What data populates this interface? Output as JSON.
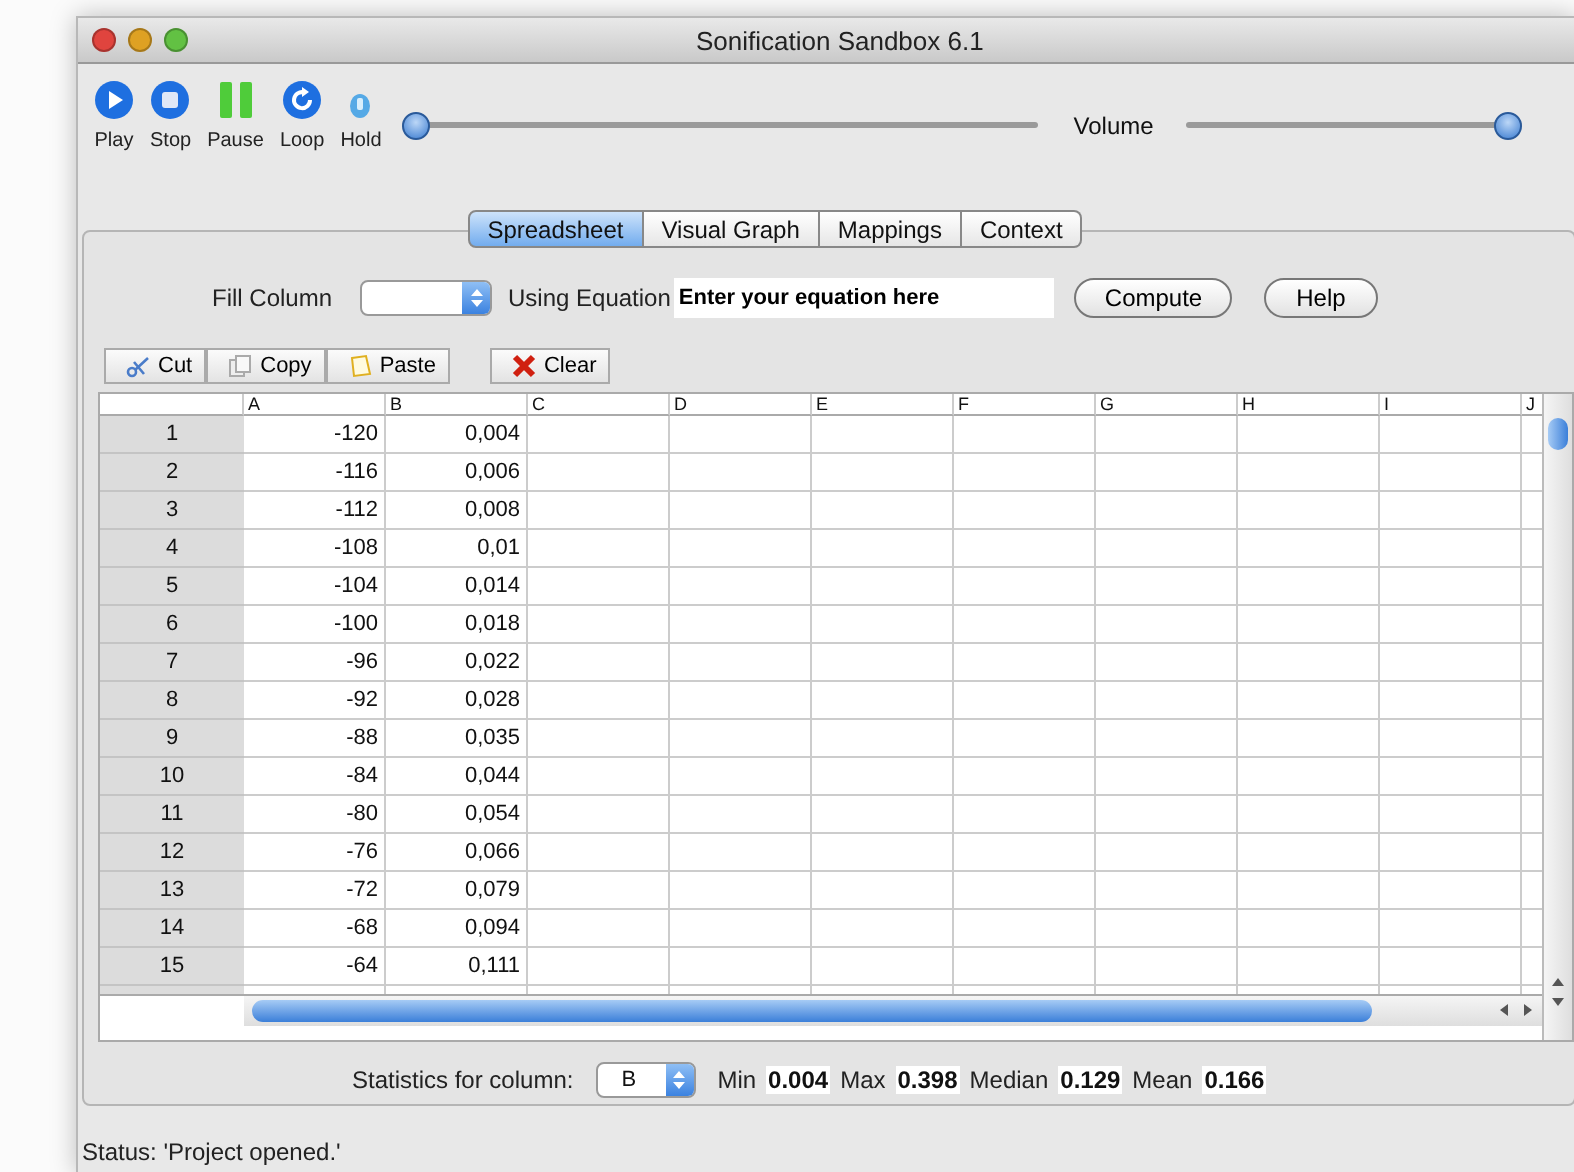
{
  "window": {
    "title": "Sonification Sandbox 6.1"
  },
  "toolbar": {
    "buttons": [
      {
        "label": "Play",
        "kind": "play"
      },
      {
        "label": "Stop",
        "kind": "stop"
      },
      {
        "label": "Pause",
        "kind": "pause"
      },
      {
        "label": "Loop",
        "kind": "loop"
      },
      {
        "label": "Hold",
        "kind": "hold"
      }
    ],
    "position_slider": {
      "level": 0
    },
    "volume": {
      "label": "Volume",
      "level": 1
    }
  },
  "tabs": [
    {
      "label": "Spreadsheet",
      "selected": true
    },
    {
      "label": "Visual Graph",
      "selected": false
    },
    {
      "label": "Mappings",
      "selected": false
    },
    {
      "label": "Context",
      "selected": false
    }
  ],
  "fill": {
    "label": "Fill Column",
    "equation_label": "Using Equation",
    "equation_placeholder": "Enter your equation here",
    "compute": "Compute",
    "help": "Help"
  },
  "edit_buttons": [
    {
      "label": "Cut",
      "kind": "cut"
    },
    {
      "label": "Copy",
      "kind": "copy"
    },
    {
      "label": "Paste",
      "kind": "paste"
    },
    {
      "label": "Clear",
      "kind": "clear"
    }
  ],
  "table": {
    "columns": [
      "A",
      "B",
      "C",
      "D",
      "E",
      "F",
      "G",
      "H",
      "I",
      "J"
    ],
    "rows": [
      {
        "index": "1",
        "cells": [
          "-120",
          "0,004"
        ]
      },
      {
        "index": "2",
        "cells": [
          "-116",
          "0,006"
        ]
      },
      {
        "index": "3",
        "cells": [
          "-112",
          "0,008"
        ]
      },
      {
        "index": "4",
        "cells": [
          "-108",
          "0,01"
        ]
      },
      {
        "index": "5",
        "cells": [
          "-104",
          "0,014"
        ]
      },
      {
        "index": "6",
        "cells": [
          "-100",
          "0,018"
        ]
      },
      {
        "index": "7",
        "cells": [
          "-96",
          "0,022"
        ]
      },
      {
        "index": "8",
        "cells": [
          "-92",
          "0,028"
        ]
      },
      {
        "index": "9",
        "cells": [
          "-88",
          "0,035"
        ]
      },
      {
        "index": "10",
        "cells": [
          "-84",
          "0,044"
        ]
      },
      {
        "index": "11",
        "cells": [
          "-80",
          "0,054"
        ]
      },
      {
        "index": "12",
        "cells": [
          "-76",
          "0,066"
        ]
      },
      {
        "index": "13",
        "cells": [
          "-72",
          "0,079"
        ]
      },
      {
        "index": "14",
        "cells": [
          "-68",
          "0,094"
        ]
      },
      {
        "index": "15",
        "cells": [
          "-64",
          "0,111"
        ]
      }
    ]
  },
  "statistics": {
    "label": "Statistics for column:",
    "column": "B",
    "items": [
      {
        "label": "Min",
        "value": "0.004"
      },
      {
        "label": "Max",
        "value": "0.398"
      },
      {
        "label": "Median",
        "value": "0.129"
      },
      {
        "label": "Mean",
        "value": "0.166"
      }
    ]
  },
  "status_bar": "Status: 'Project opened.'"
}
